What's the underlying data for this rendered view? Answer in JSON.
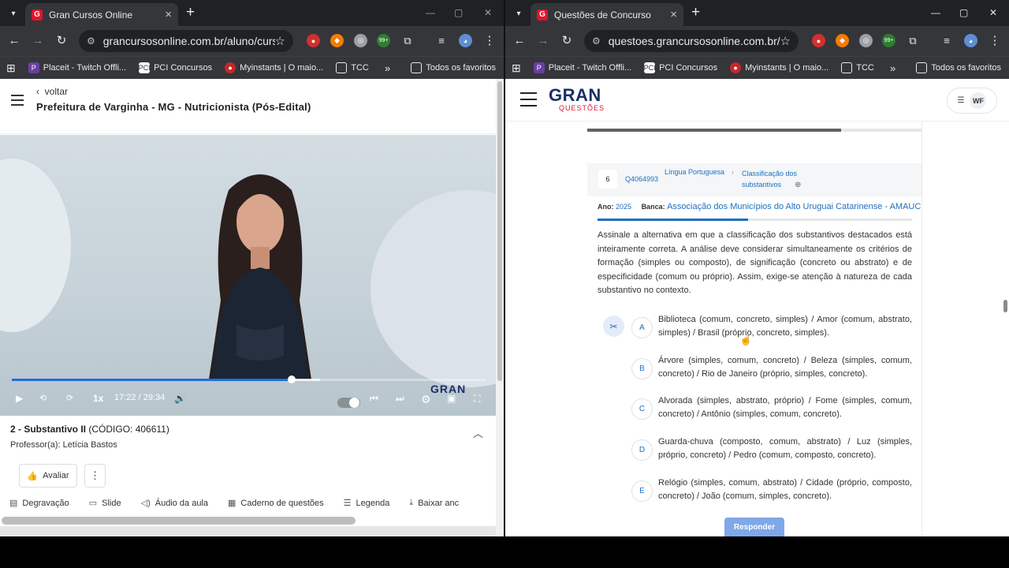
{
  "left": {
    "tab_title": "Gran Cursos Online",
    "url": "grancursosonline.com.br/aluno/curso/...",
    "bookmarks": [
      "Placeit - Twitch Offli...",
      "PCI Concursos",
      "Myinstants | O maio...",
      "TCC"
    ],
    "all_favorites": "Todos os favoritos",
    "back_label": "voltar",
    "course_title": "Prefeitura de Varginha - MG - Nutricionista (Pós-Edital)",
    "video": {
      "speed": "1x",
      "time": "17:22 / 29:34",
      "progress": 0.59,
      "buffered": 0.65,
      "watermark": "GRAN"
    },
    "lesson_title": "2 - Substantivo II",
    "lesson_code": "(CÓDIGO: 406611)",
    "professor": "Professor(a): Letícia Bastos",
    "rate_label": "Avaliar",
    "tabs": [
      "Degravação",
      "Slide",
      "Áudio da aula",
      "Caderno de questões",
      "Legenda",
      "Baixar anc"
    ]
  },
  "right": {
    "tab_title": "Questões de Concurso",
    "url": "questoes.grancursosonline.com.br/alu...",
    "bookmarks": [
      "Placeit - Twitch Offli...",
      "PCI Concursos",
      "Myinstants | O maio...",
      "TCC"
    ],
    "all_favorites": "Todos os favoritos",
    "logo_main": "GRAN",
    "logo_sub": "QUESTÕES",
    "user_initials": "WF",
    "question": {
      "number": "6",
      "id": "Q4064993",
      "subject": "Língua Portuguesa",
      "topic": "Classificação dos substantivos",
      "ano_label": "Ano:",
      "ano": "2025",
      "banca_label": "Banca:",
      "banca": "Associação dos Municípios do Alto Uruguai Catarinense - AMAUC",
      "text": "Assinale a alternativa em que a classificação dos substantivos destacados está inteiramente correta. A análise deve considerar simultaneamente os critérios de formação (simples ou composto), de significação (concreto ou abstrato) e de especificidade (comum ou próprio). Assim, exige-se atenção à natureza de cada substantivo no contexto.",
      "options": [
        {
          "letter": "A",
          "text": "Biblioteca (comum, concreto, simples) / Amor (comum, abstrato, simples) / Brasil (próprio, concreto, simples)."
        },
        {
          "letter": "B",
          "text": "Árvore (simples, comum, concreto) / Beleza (simples, comum, concreto) / Rio de Janeiro (próprio, simples, concreto)."
        },
        {
          "letter": "C",
          "text": "Alvorada (simples, abstrato, próprio) / Fome (simples, comum, concreto) / Antônio (simples, comum, concreto)."
        },
        {
          "letter": "D",
          "text": "Guarda-chuva (composto, comum, abstrato) / Luz (simples, próprio, concreto) / Pedro (comum, composto, concreto)."
        },
        {
          "letter": "E",
          "text": "Relógio (simples, comum, abstrato) / Cidade (próprio, composto, concreto) / João (comum, simples, concreto)."
        }
      ],
      "submit_label": "Responder"
    }
  },
  "extension_badge": "99+",
  "colors": {
    "brand_red": "#e0142c",
    "brand_navy": "#1b2f66",
    "link_blue": "#1f6fbf",
    "chrome_dark": "#202124"
  }
}
